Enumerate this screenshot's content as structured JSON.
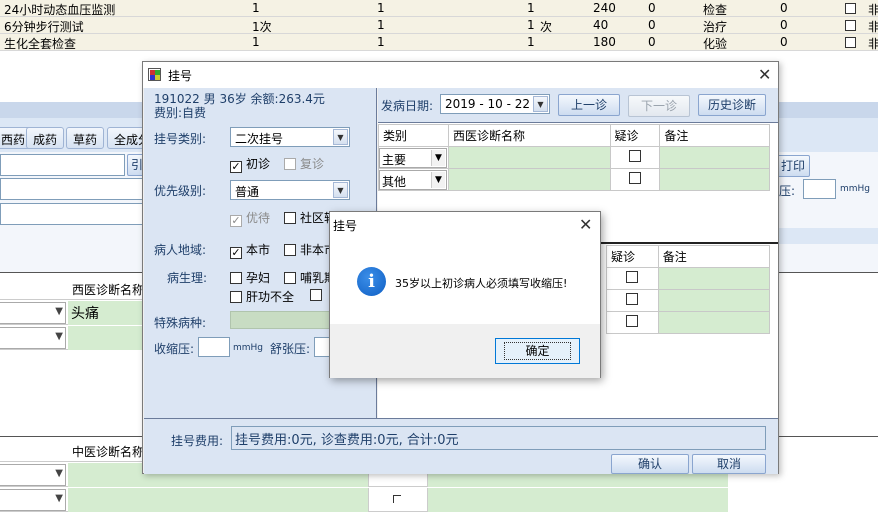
{
  "bg_rows": [
    {
      "name": "24小时动态血压监测",
      "qty": "1",
      "c2": "1",
      "c3": "1",
      "unit": "",
      "price": "240",
      "c6": "0",
      "type": "检查",
      "c8": "0",
      "c9": "非"
    },
    {
      "name": "6分钟步行测试",
      "qty": "1次",
      "c2": "1",
      "c3": "1",
      "unit": "次",
      "price": "40",
      "c6": "0",
      "type": "治疗",
      "c8": "0",
      "c9": "非"
    },
    {
      "name": "生化全套检查",
      "qty": "1",
      "c2": "1",
      "c3": "1",
      "unit": "",
      "price": "180",
      "c6": "0",
      "type": "化验",
      "c8": "0",
      "c9": "非"
    }
  ],
  "bg_tabs": [
    "西药",
    "成药",
    "草药",
    "全成分"
  ],
  "bg_cite": "引",
  "bg_print": "打印",
  "bg_pressure_label": "压:",
  "bg_unit": "mmHg",
  "bg_diag_header": "西医诊断名称",
  "bg_diag_value": "头痛",
  "bg_tcm_header": "中医诊断名称",
  "dialog": {
    "title": "挂号",
    "patient_line1": "191022 男 36岁 余额:263.4元",
    "patient_line2": "费别:自费",
    "reg_type_label": "挂号类别:",
    "reg_type_value": "二次挂号",
    "first_visit": "初诊",
    "revisit": "复诊",
    "priority_label": "优先级别:",
    "priority_value": "普通",
    "preferential": "优待",
    "community": "社区转",
    "region_label": "病人地域:",
    "local": "本市",
    "nonlocal": "非本市",
    "physio_label": "病生理:",
    "pregnant": "孕妇",
    "lactating": "哺乳期",
    "liver": "肝功不全",
    "special_label": "特殊病种:",
    "systolic_label": "收缩压:",
    "diastolic_label": "舒张压:",
    "unit": "mmHg",
    "onset_label": "发病日期:",
    "onset_date": "2019 - 10 - 22",
    "prev_btn": "上一诊",
    "next_btn": "下一诊",
    "history_btn": "历史诊断",
    "diag_headers": [
      "类别",
      "西医诊断名称",
      "疑诊",
      "备注"
    ],
    "diag_rows": [
      {
        "cat": "主要"
      },
      {
        "cat": "其他"
      }
    ],
    "tcm_headers": [
      "疑诊",
      "备注"
    ],
    "fee_label": "挂号费用:",
    "fee_value": "挂号费用:0元, 诊查费用:0元, 合计:0元",
    "ok_btn": "确认",
    "cancel_btn": "取消"
  },
  "msgbox": {
    "title": "挂号",
    "message": "35岁以上初诊病人必须填写收缩压!",
    "ok": "确定"
  }
}
